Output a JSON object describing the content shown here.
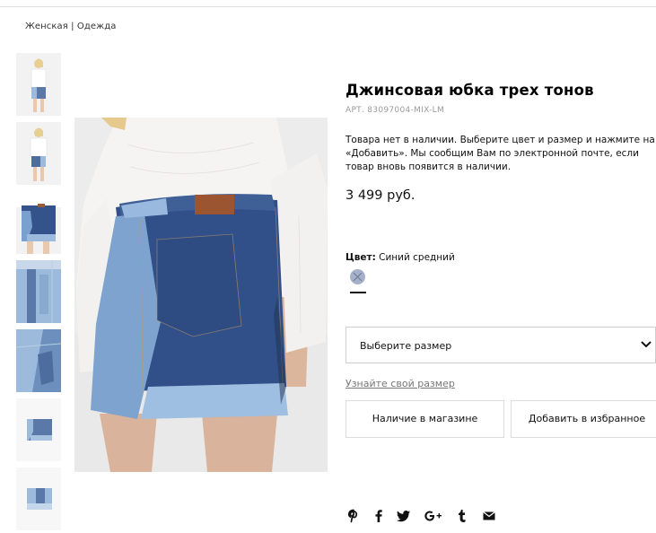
{
  "breadcrumb": {
    "section": "Женская",
    "separator": "|",
    "category": "Одежда"
  },
  "product": {
    "title": "Джинсовая юбка трех тонов",
    "ref": "АРТ. 83097004-MIX-LM",
    "stock_message": "Товара нет в наличии. Выберите цвет и размер и нажмите на «Добавить». Мы сообщим Вам по электронной почте, если товар вновь появится в наличии.",
    "price": "3 499 руб."
  },
  "color": {
    "label": "Цвет:",
    "value": "Синий средний",
    "swatch_hex": "#a4b1c9"
  },
  "size_select": {
    "placeholder": "Выберите размер",
    "icon": "chevron-down-icon"
  },
  "size_guide": "Узнайте свой размер",
  "buttons": {
    "store": "Наличие в магазине",
    "favorites": "Добавить в избранное"
  },
  "gallery": {
    "thumbnail_count": 7
  },
  "social": [
    "pinterest-icon",
    "facebook-icon",
    "twitter-icon",
    "google-plus-icon",
    "tumblr-icon",
    "email-icon"
  ],
  "colors": {
    "denim_dark": "#34538a",
    "denim_light": "#8fb0d6",
    "text": "#111111",
    "muted": "#9a9a9a"
  }
}
